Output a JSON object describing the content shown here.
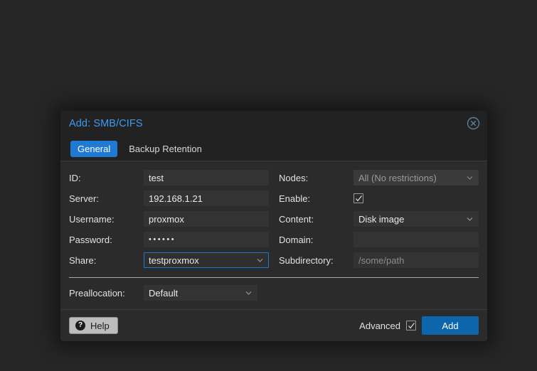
{
  "dialog": {
    "title": "Add: SMB/CIFS",
    "close_icon": "close-circle-icon"
  },
  "tabs": [
    {
      "label": "General",
      "active": true
    },
    {
      "label": "Backup Retention",
      "active": false
    }
  ],
  "form": {
    "left": [
      {
        "label": "ID:",
        "value": "test",
        "type": "text"
      },
      {
        "label": "Server:",
        "value": "192.168.1.21",
        "type": "text"
      },
      {
        "label": "Username:",
        "value": "proxmox",
        "type": "text"
      },
      {
        "label": "Password:",
        "value": "••••••",
        "type": "password"
      },
      {
        "label": "Share:",
        "value": "testproxmox",
        "type": "select",
        "focused": true
      }
    ],
    "right": [
      {
        "label": "Nodes:",
        "value": "All (No restrictions)",
        "type": "select",
        "disabled": true
      },
      {
        "label": "Enable:",
        "value": "",
        "type": "checkbox",
        "checked": true
      },
      {
        "label": "Content:",
        "value": "Disk image",
        "type": "select"
      },
      {
        "label": "Domain:",
        "value": "",
        "type": "text"
      },
      {
        "label": "Subdirectory:",
        "value": "",
        "placeholder": "/some/path",
        "type": "text"
      }
    ],
    "preallocation": {
      "label": "Preallocation:",
      "value": "Default",
      "type": "select"
    }
  },
  "footer": {
    "help_label": "Help",
    "help_icon": "question-mark-icon",
    "advanced_label": "Advanced",
    "advanced_checked": true,
    "add_label": "Add"
  },
  "colors": {
    "accent_blue": "#1f7ad4",
    "title_blue": "#3f9bf0",
    "add_button": "#0d66ab",
    "dialog_bg": "#2b2b2b",
    "titlebar_bg": "#222222",
    "field_bg": "#333333",
    "page_bg": "#262626"
  }
}
